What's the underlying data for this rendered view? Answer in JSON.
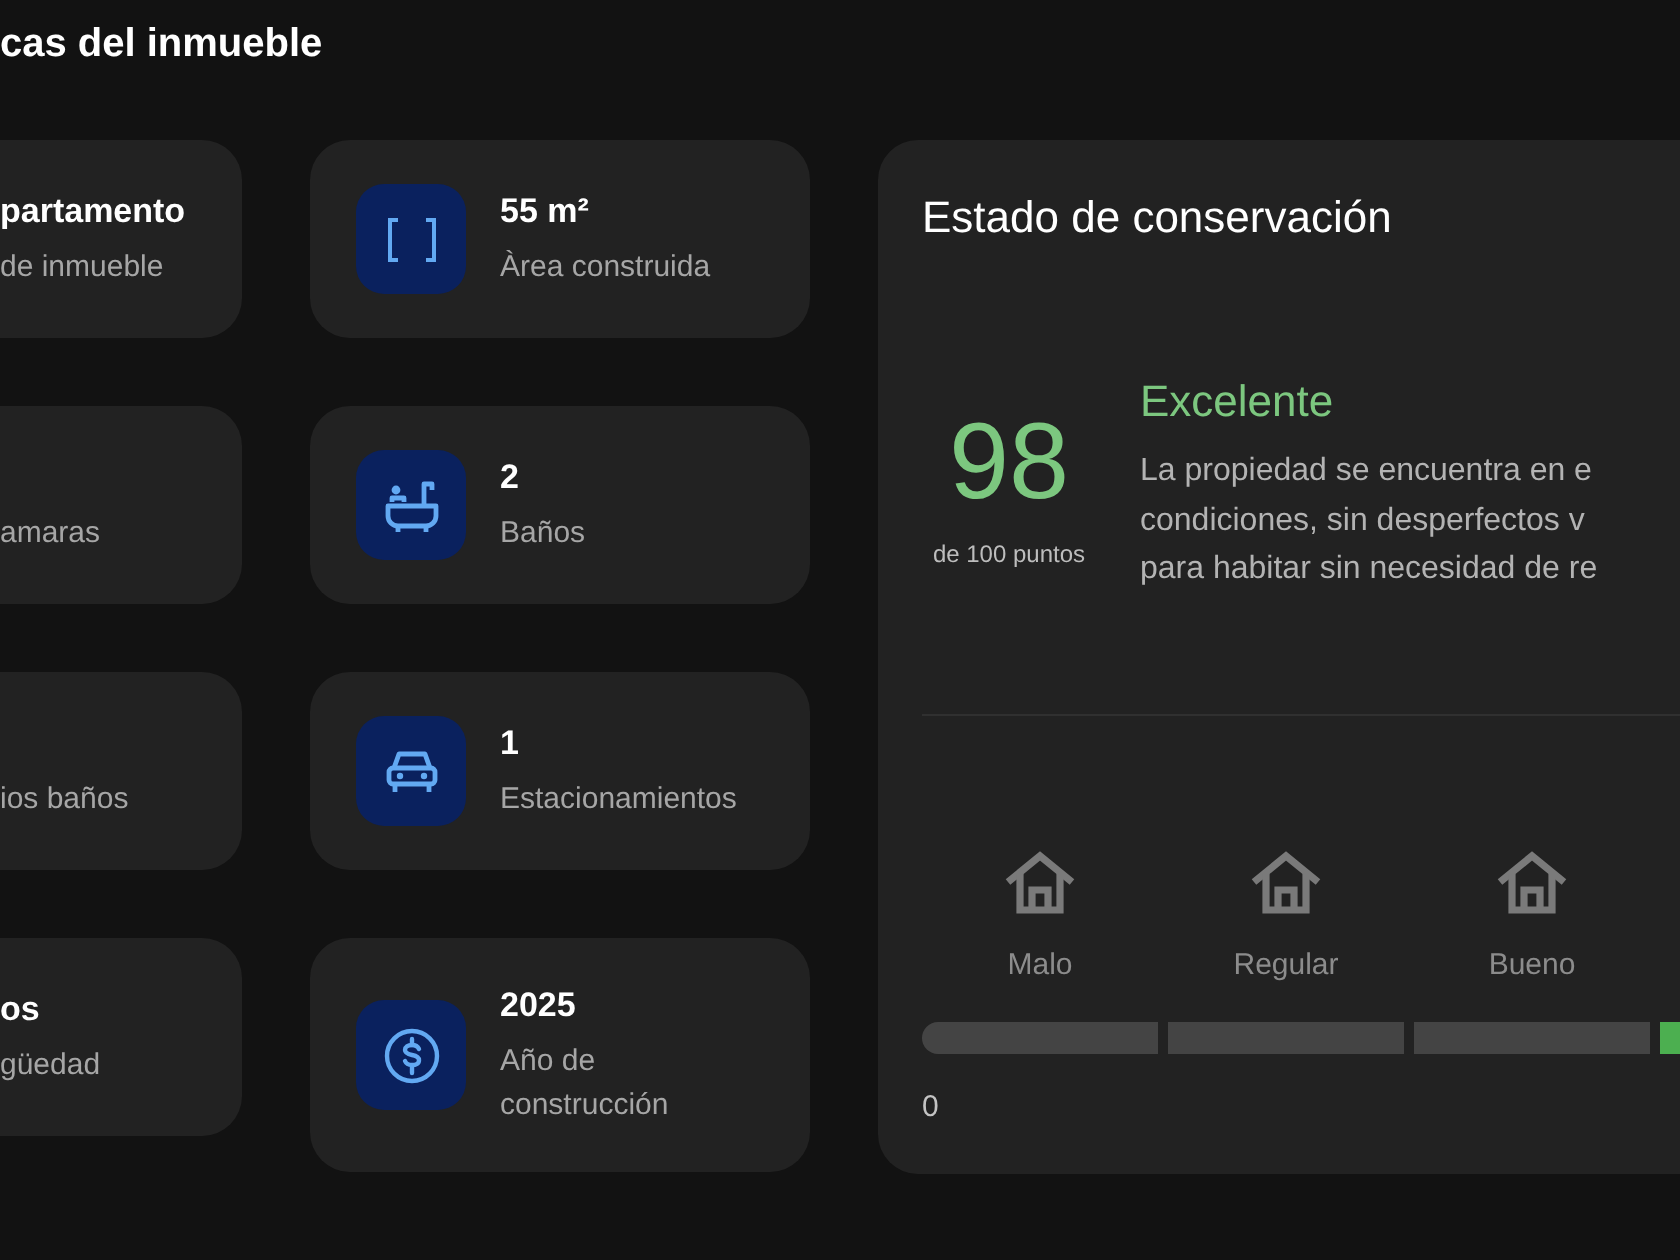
{
  "section": {
    "title": "cas del inmueble"
  },
  "left_cards": [
    {
      "value": "partamento",
      "label": "de inmueble"
    },
    {
      "label": "amaras"
    },
    {
      "label": "ios baños"
    },
    {
      "value": "os",
      "label": "güedad"
    }
  ],
  "right_cards": [
    {
      "value": "55 m²",
      "label": "Àrea construida"
    },
    {
      "value": "2",
      "label": "Baños"
    },
    {
      "value": "1",
      "label": "Estacionamientos"
    },
    {
      "value": "2025",
      "label": "Año de construcción"
    }
  ],
  "conservation": {
    "title": "Estado de conservación",
    "score": "98",
    "score_caption": "de 100 puntos",
    "rating": "Excelente",
    "description_lines": [
      "La propiedad se encuentra en e",
      "condiciones, sin desperfectos v",
      "para habitar sin necesidad de re"
    ],
    "scale": [
      {
        "label": "Malo",
        "selected": false
      },
      {
        "label": "Regular",
        "selected": false
      },
      {
        "label": "Bueno",
        "selected": false
      },
      {
        "selected": true
      }
    ],
    "scale_start": "0"
  }
}
